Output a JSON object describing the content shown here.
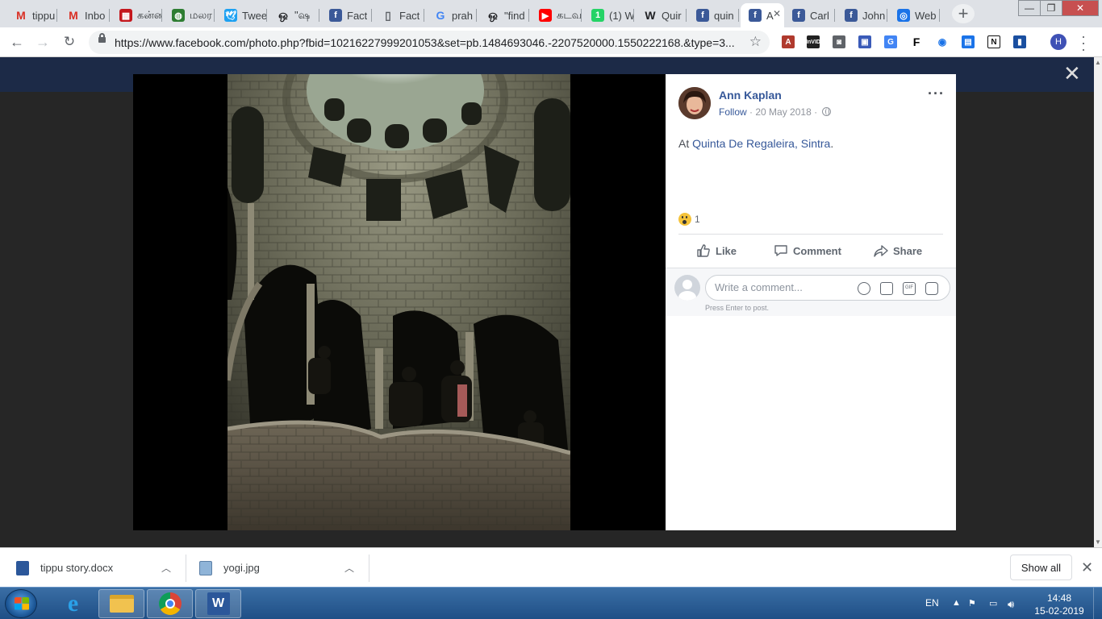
{
  "browser": {
    "tabs": [
      {
        "title": "tippu",
        "icon": "gmail-icon",
        "color": "#d93025"
      },
      {
        "title": "Inbo",
        "icon": "gmail-icon",
        "color": "#d93025"
      },
      {
        "title": "கன்ன",
        "icon": "news-icon",
        "color": "#c4161c"
      },
      {
        "title": "மலர",
        "icon": "globe-icon",
        "color": "#2e7d32"
      },
      {
        "title": "Twee",
        "icon": "twitter-icon",
        "color": "#1da1f2"
      },
      {
        "title": "\"ஷ",
        "icon": "search-icon",
        "color": "#202124"
      },
      {
        "title": "Fact",
        "icon": "facebook-icon",
        "color": "#3b5998"
      },
      {
        "title": "Fact",
        "icon": "document-icon",
        "color": "#5f6368"
      },
      {
        "title": "prah",
        "icon": "google-icon",
        "color": "#4285f4"
      },
      {
        "title": "\"find",
        "icon": "search-icon",
        "color": "#202124"
      },
      {
        "title": "கடவ",
        "icon": "youtube-icon",
        "color": "#ff0000"
      },
      {
        "title": "(1) W",
        "icon": "whatsapp-icon",
        "color": "#25d366"
      },
      {
        "title": "Quir",
        "icon": "wikipedia-icon",
        "color": "#202124"
      },
      {
        "title": "quin",
        "icon": "facebook-icon",
        "color": "#3b5998"
      },
      {
        "title": "A",
        "icon": "facebook-icon",
        "color": "#3b5998",
        "active": true
      },
      {
        "title": "Carl",
        "icon": "facebook-icon",
        "color": "#3b5998"
      },
      {
        "title": "John",
        "icon": "facebook-icon",
        "color": "#3b5998"
      },
      {
        "title": "Web",
        "icon": "web-icon",
        "color": "#1a73e8"
      }
    ],
    "url": "https://www.facebook.com/photo.php?fbid=10216227999201053&set=pb.1484693046.-2207520000.1550222168.&type=3...",
    "profile_initial": "H"
  },
  "post": {
    "author": "Ann Kaplan",
    "follow": "Follow",
    "date": "20 May 2018",
    "meta_sep": "·",
    "caption_prefix": "At",
    "location": "Quinta De Regaleira, Sintra",
    "caption_suffix": ".",
    "reaction_count": "1",
    "actions": {
      "like": "Like",
      "comment": "Comment",
      "share": "Share"
    },
    "comment_placeholder": "Write a comment...",
    "comment_hint": "Press Enter to post."
  },
  "downloads": {
    "items": [
      {
        "name": "tippu story.docx",
        "icon": "word-doc-icon"
      },
      {
        "name": "yogi.jpg",
        "icon": "image-file-icon"
      }
    ],
    "show_all": "Show all"
  },
  "taskbar": {
    "language": "EN",
    "time": "14:48",
    "date": "15-02-2019"
  }
}
